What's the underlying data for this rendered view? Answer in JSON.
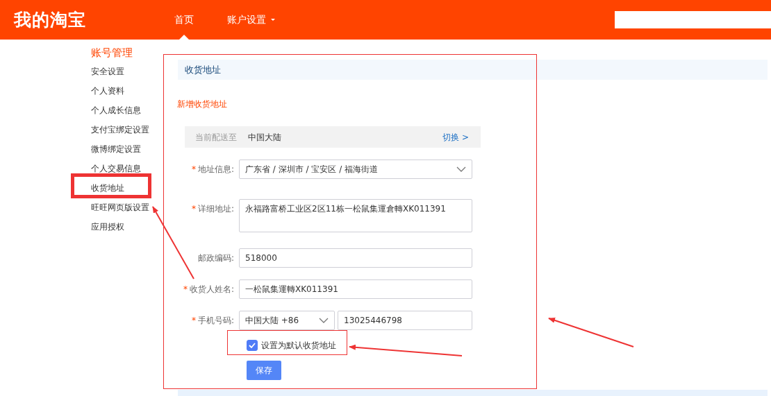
{
  "header": {
    "logo": "我的淘宝",
    "nav": [
      {
        "label": "首页",
        "kind": "link",
        "selected": true
      },
      {
        "label": "账户设置",
        "kind": "dropdown",
        "selected": false
      }
    ]
  },
  "sidebar": {
    "title": "账号管理",
    "items": [
      "安全设置",
      "个人资料",
      "个人成长信息",
      "支付宝绑定设置",
      "微博绑定设置",
      "个人交易信息",
      "收货地址",
      "旺旺网页版设置",
      "应用授权"
    ]
  },
  "panel": {
    "title": "收货地址",
    "add_link": "新增收货地址",
    "delivery": {
      "label": "当前配送至",
      "value": "中国大陆",
      "switch_link": "切换 >"
    },
    "fields": [
      {
        "kind": "select",
        "label": "地址信息:",
        "required_mark": "*",
        "value": "广东省 / 深圳市 / 宝安区 / 福海街道"
      },
      {
        "kind": "textarea",
        "label": "详细地址:",
        "required_mark": "*",
        "value": "永福路富桥工业区2区11栋一松鼠集運倉轉XK011391"
      },
      {
        "kind": "input",
        "label": "邮政编码:",
        "value": "518000"
      },
      {
        "kind": "input",
        "label": "收货人姓名:",
        "required_mark": "*",
        "value": "一松鼠集運轉XK011391"
      },
      {
        "kind": "phone",
        "label": "手机号码:",
        "required_mark": "*",
        "country": "中国大陆 +86",
        "value": "13025446798"
      }
    ],
    "default_checkbox": {
      "label": "设置为默认收货地址",
      "checked": true
    },
    "save_button": "保存"
  }
}
